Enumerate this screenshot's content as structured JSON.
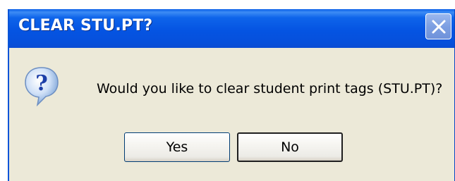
{
  "window": {
    "title": "CLEAR STU.PT?",
    "close_icon": "close-icon"
  },
  "dialog": {
    "icon": "question-icon",
    "message": "Would you like to clear student print tags (STU.PT)?",
    "buttons": {
      "yes_label": "Yes",
      "no_label": "No"
    }
  },
  "colors": {
    "titlebar": "#0554e2",
    "dialog_bg": "#ece9d8",
    "close_button": "#7d9fe2"
  }
}
